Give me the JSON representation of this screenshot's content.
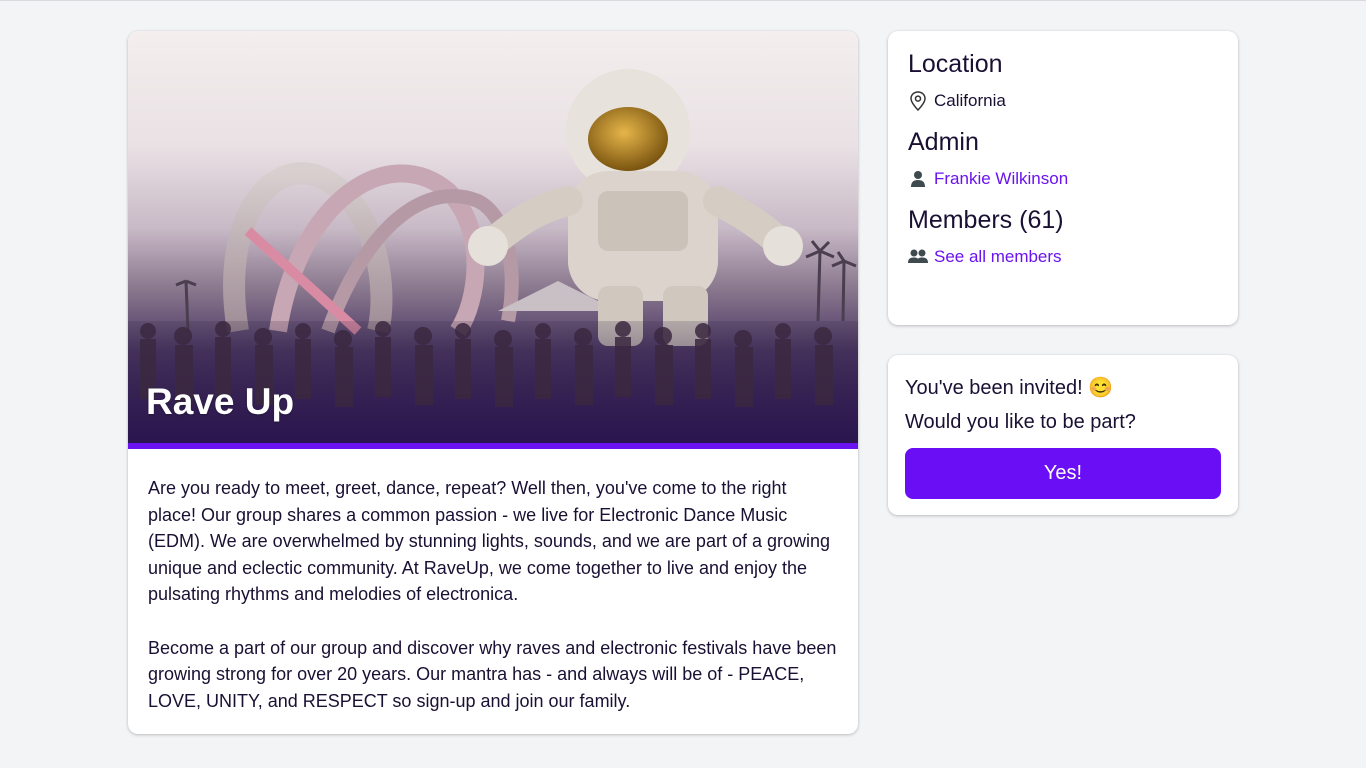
{
  "group": {
    "title": "Rave Up",
    "description": [
      "Are you ready to meet, greet, dance, repeat? Well then, you've come to the right place! Our group shares a common passion - we live for Electronic Dance Music (EDM). We are overwhelmed by stunning lights, sounds, and we are part of a growing unique and eclectic community. At RaveUp, we come together to live and enjoy the pulsating rhythms and melodies of electronica.",
      "Become a part of our group and discover why raves and electronic festivals have been growing strong for over 20 years. Our mantra has - and always will be of - PEACE, LOVE, UNITY, and RESPECT so sign-up and join our family."
    ]
  },
  "info": {
    "location_heading": "Location",
    "location_value": "California",
    "location_icon": "map-pin-icon",
    "admin_heading": "Admin",
    "admin_name": "Frankie Wilkinson",
    "admin_icon": "user-icon",
    "members_heading": "Members (61)",
    "members_link": "See all members",
    "members_icon": "users-icon"
  },
  "invite": {
    "line1": "You've been invited! 😊",
    "line2": "Would you like to be part?",
    "button_label": "Yes!"
  },
  "colors": {
    "accent": "#6a0ff5",
    "link": "#6a12f0",
    "background": "#f3f4f6",
    "text": "#1a1033"
  }
}
